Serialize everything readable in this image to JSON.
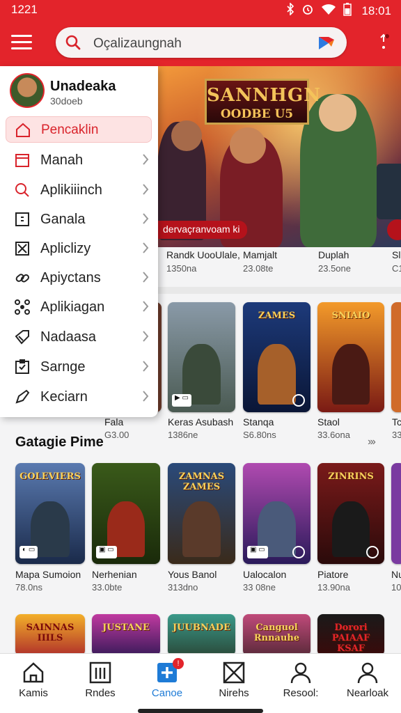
{
  "status": {
    "time": "1221",
    "clock": "18:01"
  },
  "search": {
    "placeholder": "Oçalizaungnah"
  },
  "banner": {
    "logo_line1": "SANNHGN",
    "logo_line2": "OODBE U5",
    "tag": "dervaçranvoam ki",
    "captions": [
      {
        "name": "Randk UooUlale,",
        "size": "1350na"
      },
      {
        "name": "Mamjalt",
        "size": "23.08te"
      },
      {
        "name": "Duplah",
        "size": "23.5one"
      },
      {
        "name": "Sl",
        "size": "C1"
      }
    ]
  },
  "user": {
    "name": "Unadeaka",
    "sub": "30doeb"
  },
  "menu": [
    {
      "label": "Pencaklin",
      "icon": "home-icon"
    },
    {
      "label": "Manah",
      "icon": "calendar-icon"
    },
    {
      "label": "Aplikiiinch",
      "icon": "search-icon"
    },
    {
      "label": "Ganala",
      "icon": "document-icon"
    },
    {
      "label": "Apliclizy",
      "icon": "shuffle-icon"
    },
    {
      "label": "Apiyctans",
      "icon": "link-icon"
    },
    {
      "label": "Aplikiagan",
      "icon": "network-icon"
    },
    {
      "label": "Nadaasa",
      "icon": "tag-icon"
    },
    {
      "label": "Sarnge",
      "icon": "clipboard-icon"
    },
    {
      "label": "Keciarn",
      "icon": "pen-icon"
    }
  ],
  "row1": [
    {
      "name": "Fala",
      "size": "Ǵ​3.00",
      "cap": ""
    },
    {
      "name": "Keras Asubash",
      "size": "1386ne",
      "cap": ""
    },
    {
      "name": "Stanqa",
      "size": "S6.80ns",
      "cap": "ZAMES"
    },
    {
      "name": "Staol",
      "size": "33.6ona",
      "cap": "SNIAIO"
    },
    {
      "name": "Tc",
      "size": "33",
      "cap": ""
    }
  ],
  "section": {
    "title": "Gatagie Pime",
    "more": "›››"
  },
  "row2": [
    {
      "name": "Mapa Sumoion",
      "size": "78.0ns",
      "cap": "GOLEVIERS"
    },
    {
      "name": "Nerhenian",
      "size": "33.0bte",
      "cap": ""
    },
    {
      "name": "Yous Banol",
      "size": "313dno",
      "cap": "ZAMNAS ZAMES"
    },
    {
      "name": "Ualocalon",
      "size": "33 08ne",
      "cap": ""
    },
    {
      "name": "Piatore",
      "size": "13.90na",
      "cap": "ZINRINS"
    },
    {
      "name": "Nu",
      "size": "10",
      "cap": ""
    }
  ],
  "row3": [
    {
      "cap": "SAINNAS IIILS"
    },
    {
      "cap": "JUSTANE"
    },
    {
      "cap": "JUUBNADE"
    },
    {
      "cap": "Canguol Rnnauhe"
    },
    {
      "cap": "Dorori PAIAAF KSAF"
    }
  ],
  "nav": [
    {
      "label": "Kamis",
      "icon": "home-icon"
    },
    {
      "label": "Rndes",
      "icon": "list-icon"
    },
    {
      "label": "Canoe",
      "icon": "add-icon",
      "badge": "!"
    },
    {
      "label": "Nirehs",
      "icon": "box-icon"
    },
    {
      "label": "Resool:",
      "icon": "person-icon"
    },
    {
      "label": "Nearloak",
      "icon": "profile-icon"
    }
  ],
  "colors": {
    "brand": "#e3242b",
    "accent": "#1e7bd6"
  }
}
